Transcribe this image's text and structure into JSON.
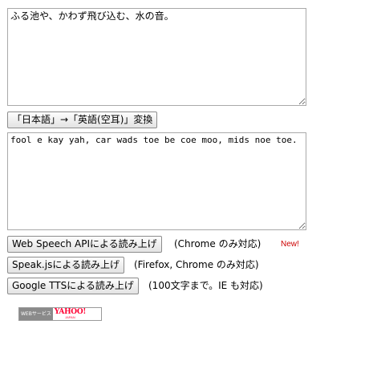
{
  "input": {
    "source_text": "ふる池や、かわず飛び込む、水の音。"
  },
  "convert": {
    "button_label": "「日本語」→「英語(空耳)」変換"
  },
  "output": {
    "converted_text": "fool e kay yah, car wads toe be coe moo, mids noe toe."
  },
  "speech": {
    "web_speech": {
      "button_label": "Web Speech APIによる読み上げ",
      "note": "(Chrome のみ対応)",
      "badge": "New!"
    },
    "speak_js": {
      "button_label": "Speak.jsによる読み上げ",
      "note": "(Firefox, Chrome のみ対応)"
    },
    "google_tts": {
      "button_label": "Google TTSによる読み上げ",
      "note": "(100文字まで。IE も対応)"
    }
  },
  "credit": {
    "label": "WEBサービス",
    "logo_text": "YAHOO!",
    "logo_sub": "JAPAN"
  },
  "colors": {
    "new_badge": "#cc0000",
    "yahoo_red": "#ff0033"
  }
}
